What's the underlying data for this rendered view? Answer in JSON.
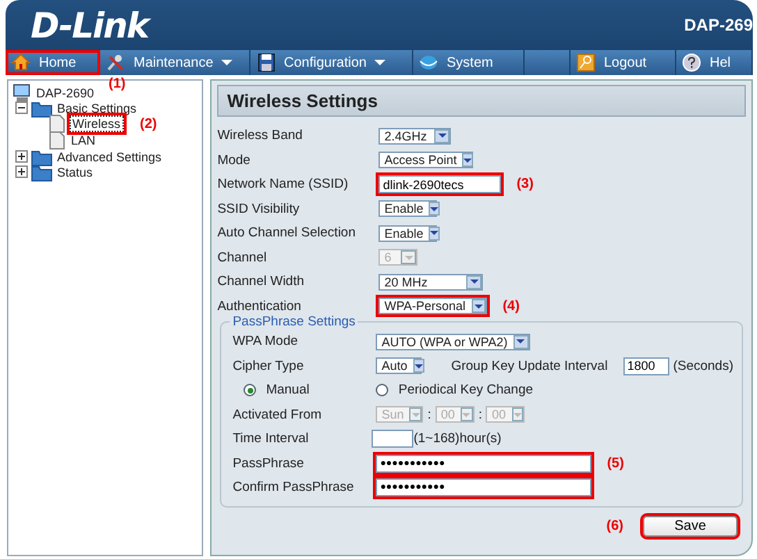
{
  "header": {
    "logo": "D-Link",
    "model": "DAP-269"
  },
  "nav": [
    {
      "label": "Home",
      "dropdown": false,
      "highlighted": true,
      "annotation": "(1)"
    },
    {
      "label": "Maintenance",
      "dropdown": true,
      "highlighted": false
    },
    {
      "label": "Configuration",
      "dropdown": true,
      "highlighted": false
    },
    {
      "label": "System",
      "dropdown": false,
      "highlighted": false
    },
    {
      "label": "Logout",
      "dropdown": false,
      "highlighted": false
    },
    {
      "label": "Hel",
      "dropdown": false,
      "highlighted": false
    }
  ],
  "tree": {
    "label": "DAP-2690",
    "children": [
      {
        "label": "Basic Settings",
        "expanded": true,
        "children": [
          {
            "label": "Wireless",
            "selected": true,
            "annotation": "(2)"
          },
          {
            "label": "LAN",
            "selected": false
          }
        ]
      },
      {
        "label": "Advanced Settings",
        "expanded": false
      },
      {
        "label": "Status",
        "expanded": false
      }
    ]
  },
  "panel": {
    "title": "Wireless Settings",
    "rows": [
      {
        "kind": "select",
        "label": "Wireless Band",
        "value": "2.4GHz",
        "disabled": false,
        "highlighted": false
      },
      {
        "kind": "select",
        "label": "Mode",
        "value": "Access Point",
        "disabled": false,
        "highlighted": false
      },
      {
        "kind": "text",
        "label": "Network Name (SSID)",
        "value": "dlink-2690tecs",
        "highlighted": true,
        "annotation": "(3)"
      },
      {
        "kind": "select",
        "label": "SSID Visibility",
        "value": "Enable",
        "disabled": false,
        "highlighted": false
      },
      {
        "kind": "select",
        "label": "Auto Channel Selection",
        "value": "Enable",
        "disabled": false,
        "highlighted": false
      },
      {
        "kind": "select",
        "label": "Channel",
        "value": "6",
        "disabled": true,
        "highlighted": false
      },
      {
        "kind": "select",
        "label": "Channel Width",
        "value": "20 MHz",
        "disabled": false,
        "highlighted": false
      },
      {
        "kind": "select",
        "label": "Authentication",
        "value": "WPA-Personal",
        "disabled": false,
        "highlighted": true,
        "annotation": "(4)"
      }
    ],
    "fieldset": {
      "legend": "PassPhrase Settings",
      "rows": [
        {
          "kind": "select",
          "label": "WPA Mode",
          "value": "AUTO (WPA or WPA2)",
          "disabled": false,
          "highlighted": false
        },
        {
          "kind": "cipher",
          "label": "Cipher Type",
          "value": "Auto",
          "interval_label": "Group Key Update Interval",
          "interval_value": "1800",
          "unit": "(Seconds)"
        },
        {
          "kind": "radio",
          "options": [
            {
              "label": "Manual",
              "selected": true
            },
            {
              "label": "Periodical Key Change",
              "selected": false
            }
          ]
        },
        {
          "kind": "time",
          "label": "Activated From",
          "parts": [
            {
              "value": "Sun"
            },
            {
              "separator": ":",
              "value": "00"
            },
            {
              "separator": ":",
              "value": "00"
            }
          ],
          "disabled": true
        },
        {
          "kind": "text",
          "label": "Time Interval",
          "value": "",
          "suffix": "(1~168)hour(s)",
          "highlighted": false
        },
        {
          "kind": "password",
          "label": "PassPhrase",
          "value": "●●●●●●●●●●●",
          "highlighted": true,
          "annotation": "(5)"
        },
        {
          "kind": "password",
          "label": "Confirm PassPhrase",
          "value": "●●●●●●●●●●●",
          "highlighted": true
        }
      ]
    },
    "save": {
      "label": "Save",
      "highlighted": true,
      "annotation": "(6)"
    }
  }
}
